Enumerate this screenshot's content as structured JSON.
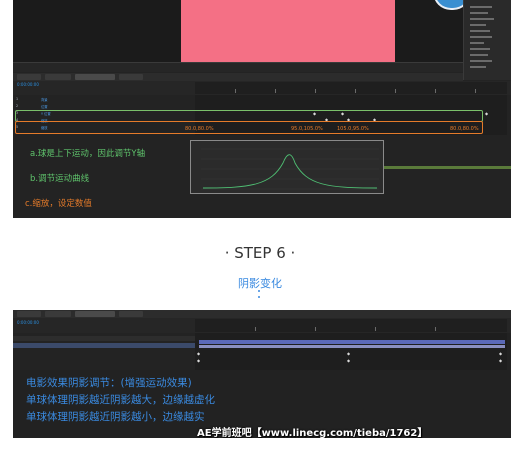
{
  "top_screenshot": {
    "timecode": "0:00:00:00",
    "layer_rows": [
      {
        "label": "1",
        "name": "背景"
      },
      {
        "label": "2",
        "name": "位置"
      },
      {
        "label": "3",
        "name": "Y 位置"
      },
      {
        "label": "4",
        "name": "缩放"
      },
      {
        "label": "5",
        "name": "缩放"
      }
    ],
    "keyframe_values": [
      "80.0,80.0%",
      "95.0,105.0%",
      "105.0,95.0%",
      "80.0,80.0%"
    ],
    "annotations": {
      "a": "a.球是上下运动，因此调节Y轴",
      "b": "b.调节运动曲线",
      "c": "c.缩放，设定数值"
    }
  },
  "step_heading": "· STEP 6 ·",
  "section_title": "阴影变化",
  "bottom_screenshot": {
    "timecode": "0:00:00:00",
    "notes": [
      "电影效果阴影调节：(增强运动效果)",
      "单球体理阴影越近阴影越大，边缘越虚化",
      "单球体理阴影越近阴影越小，边缘越实"
    ],
    "watermark": "AE学前班吧【www.linecg.com/tieba/1762】"
  },
  "colors": {
    "pink_comp": "#f47085",
    "ui_blue": "#3a8ae0",
    "green_note": "#5fc46c",
    "orange_note": "#e57b2a"
  }
}
